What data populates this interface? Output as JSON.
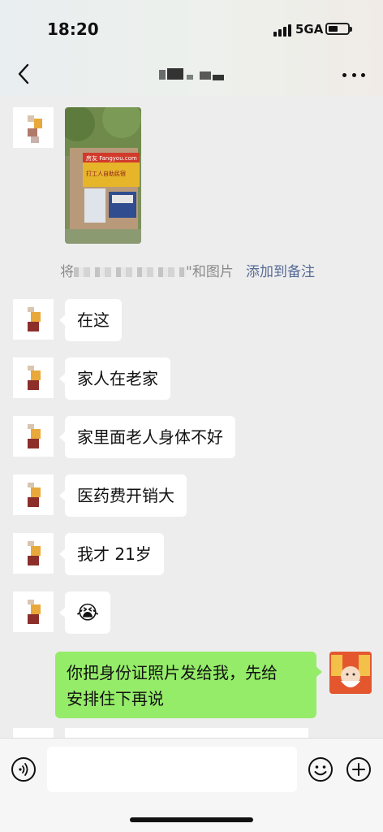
{
  "status_bar": {
    "time": "18:20",
    "network": "5GA"
  },
  "header": {
    "back_icon": "chevron-left-icon",
    "contact_name_blurred": true,
    "more_icon": "more-dots-icon"
  },
  "messages": [
    {
      "side": "left",
      "type": "image",
      "content": "photo of building with sign",
      "sign_text": "房友 Fangyou.com",
      "sign_sub": "打工人自助民宿"
    },
    {
      "side": "left",
      "type": "text",
      "text": "在这"
    },
    {
      "side": "left",
      "type": "text",
      "text": "家人在老家"
    },
    {
      "side": "left",
      "type": "text",
      "text": "家里面老人身体不好"
    },
    {
      "side": "left",
      "type": "text",
      "text": "医药费开销大"
    },
    {
      "side": "left",
      "type": "text",
      "text": "我才 21岁"
    },
    {
      "side": "left",
      "type": "emoji",
      "text": "😭"
    },
    {
      "side": "right",
      "type": "text",
      "line1": "你把身份证照片发给我，先给",
      "line2": "安排住下再说"
    }
  ],
  "system_notice": {
    "prefix": "将",
    "suffix": "\"和图片",
    "link": "添加到备注"
  },
  "input_bar": {
    "voice_icon": "voice-icon",
    "placeholder": "",
    "emoji_icon": "emoji-icon",
    "plus_icon": "plus-icon"
  },
  "colors": {
    "background": "#ededed",
    "bubble_left": "#ffffff",
    "bubble_right": "#95ec69",
    "link": "#576b95"
  }
}
